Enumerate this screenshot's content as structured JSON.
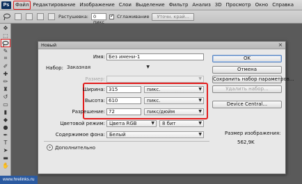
{
  "menubar": {
    "logo": "Ps",
    "items": [
      "Файл",
      "Редактирование",
      "Изображение",
      "Слои",
      "Выделение",
      "Фильтр",
      "Анализ",
      "3D",
      "Просмотр",
      "Окно",
      "Справка"
    ]
  },
  "options": {
    "feather_label": "Растушевка:",
    "feather_value": "0 пикс",
    "antialias_label": "Сглаживание",
    "refine_button": "Уточн. край..."
  },
  "watermark": "www.hrelinks.ru",
  "dialog": {
    "title": "Новый",
    "name_label": "Имя:",
    "name_value": "Без имени-1",
    "preset_label": "Набор:",
    "preset_value": "Заказная",
    "size_label": "Размер:",
    "width_label": "Ширина:",
    "width_value": "315",
    "width_unit": "пикс.",
    "height_label": "Высота:",
    "height_value": "610",
    "height_unit": "пикс.",
    "resolution_label": "Разрешение:",
    "resolution_value": "72",
    "resolution_unit": "пикс/дюйм",
    "color_mode_label": "Цветовой режим:",
    "color_mode_value": "Цвета RGB",
    "bit_depth_value": "8 бит",
    "background_label": "Содержимое фона:",
    "background_value": "Белый",
    "advanced_label": "Дополнительно",
    "ok_button": "OK",
    "cancel_button": "Отмена",
    "save_preset_button": "Сохранить набор параметров...",
    "delete_preset_button": "Удалить набор...",
    "device_central_button": "Device Central...",
    "image_size_label": "Размер изображения:",
    "image_size_value": "562,9K"
  },
  "colors": {
    "highlight": "#e21b1b",
    "workspace": "#5a5a5a",
    "dialog_bg": "#e8e8e8"
  }
}
